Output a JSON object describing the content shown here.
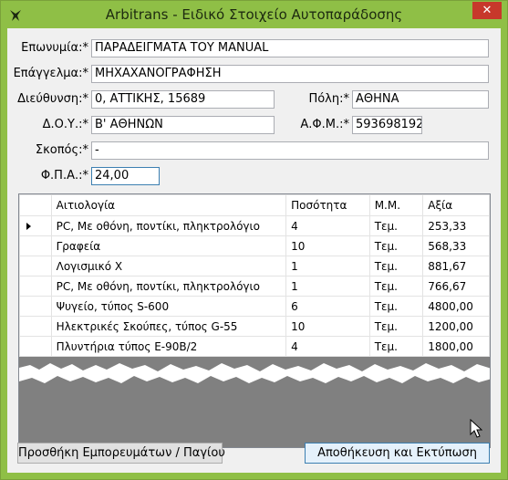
{
  "window": {
    "title": "Arbitrans - Ειδικό Στοιχείο Αυτοπαράδοσης",
    "close": "✕"
  },
  "form": {
    "name_label": "Επωνυμία:*",
    "name_value": "ΠΑΡΑΔΕΙΓΜΑΤΑ ΤΟΥ MANUAL",
    "profession_label": "Επάγγελμα:*",
    "profession_value": "ΜΗΧΑΧΑΝΟΓΡΑΦΗΣΗ",
    "address_label": "Διεύθυνση:*",
    "address_value": "0, ΑΤΤΙΚΗΣ, 15689",
    "city_label": "Πόλη:*",
    "city_value": "ΑΘΗΝΑ",
    "doy_label": "Δ.Ο.Υ.:*",
    "doy_value": "Β' ΑΘΗΝΩΝ",
    "afm_label": "Α.Φ.Μ.:*",
    "afm_value": "593698192",
    "purpose_label": "Σκοπός:*",
    "purpose_value": "-",
    "vat_label": "Φ.Π.Α.:*",
    "vat_value": "24,00"
  },
  "grid": {
    "headers": [
      "Αιτιολογία",
      "Ποσότητα",
      "Μ.Μ.",
      "Αξία"
    ],
    "rows": [
      [
        "PC, Με οθόνη, ποντίκι, πληκτρολόγιο",
        "4",
        "Τεμ.",
        "253,33"
      ],
      [
        "Γραφεία",
        "10",
        "Τεμ.",
        "568,33"
      ],
      [
        "Λογισμικό Χ",
        "1",
        "Τεμ.",
        "881,67"
      ],
      [
        "PC, Με οθόνη, ποντίκι, πληκτρολόγιο",
        "1",
        "Τεμ.",
        "766,67"
      ],
      [
        "Ψυγείο, τύπος S-600",
        "6",
        "Τεμ.",
        "4800,00"
      ],
      [
        "Ηλεκτρικές Σκούπες, τύπος G-55",
        "10",
        "Τεμ.",
        "1200,00"
      ],
      [
        "Πλυντήρια τύπος Ε-90Β/2",
        "4",
        "Τεμ.",
        "1800,00"
      ]
    ]
  },
  "buttons": {
    "add": "Προσθήκη Εμπορευμάτων / Παγίου",
    "save_print": "Αποθήκευση και Εκτύπωση"
  }
}
